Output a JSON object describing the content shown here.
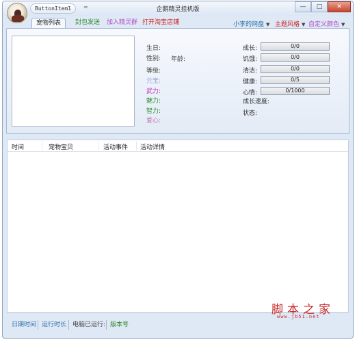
{
  "app": {
    "title": "企鹅精灵挂机版",
    "qat_label": "ButtonItem1",
    "qat_arrow": "=",
    "window_buttons": {
      "minimize": "—",
      "maximize": "□",
      "close": "✕"
    }
  },
  "tabs": [
    {
      "label": "宠物列表",
      "active": true
    },
    {
      "label": "封包发送"
    },
    {
      "label": "加入精灵群"
    },
    {
      "label": "打开淘宝店铺"
    }
  ],
  "right_menu": {
    "items": [
      {
        "label": "小李的网盘"
      },
      {
        "label": "主题风格"
      },
      {
        "label": "自定义颜色"
      }
    ],
    "arrow": "▼"
  },
  "pet_info": {
    "birthday": "生日:",
    "gender": "性别:",
    "age": "年龄:",
    "level": "等级:",
    "yuanbao": "元宝:",
    "wuli": "武力:",
    "meili": "魅力:",
    "zhili": "智力:",
    "aixin": "爱心:"
  },
  "stats": {
    "growth": {
      "label": "成长:",
      "value": "0/0"
    },
    "hunger": {
      "label": "饥饿:",
      "value": "0/0"
    },
    "clean": {
      "label": "清洁:",
      "value": "0/0"
    },
    "health": {
      "label": "健康:",
      "value": "0/5"
    },
    "mood": {
      "label": "心情:",
      "value": "0/1000"
    },
    "growth_speed": "成长速度:",
    "status": "状态:"
  },
  "list": {
    "columns": [
      "时间",
      "宠物宝贝",
      "活动事件",
      "活动详情"
    ]
  },
  "statusbar": {
    "items": [
      "日期时间",
      "运行时长",
      "电脑已运行:",
      "版本号"
    ]
  },
  "watermark": {
    "text": "脚本之家",
    "url": "www.jb51.net"
  },
  "colors": {
    "frame": "#dfe8f5",
    "accent_green": "#2e8b2e",
    "accent_purple": "#b24fc6",
    "accent_red": "#cc2222",
    "watermark": "#c62727"
  }
}
